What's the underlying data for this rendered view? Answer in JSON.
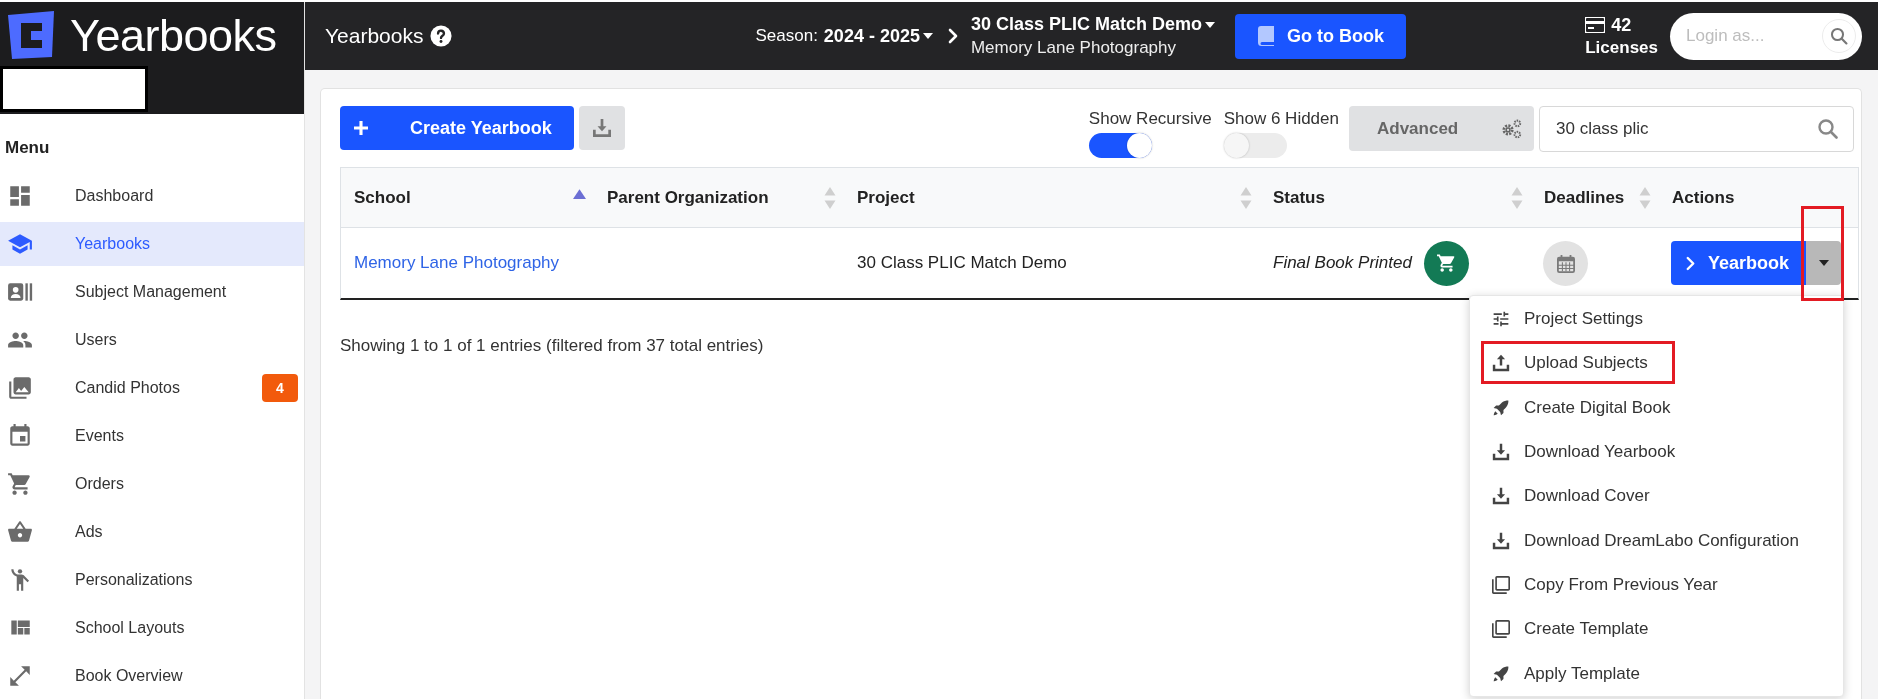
{
  "brand": {
    "name": "Yearbooks"
  },
  "header": {
    "title": "Yearbooks",
    "season_label": "Season:",
    "season": "2024 - 2025",
    "project": "30 Class PLIC Match Demo",
    "school": "Memory Lane Photography",
    "go_button": "Go to Book",
    "licenses_count": "42",
    "licenses_label": "Licenses",
    "login_field": {
      "placeholder": "Login as..."
    }
  },
  "sidebar": {
    "heading": "Menu",
    "items": [
      {
        "label": "Dashboard",
        "selected": false
      },
      {
        "label": "Yearbooks",
        "selected": true
      },
      {
        "label": "Subject Management",
        "selected": false
      },
      {
        "label": "Users",
        "selected": false
      },
      {
        "label": "Candid Photos",
        "selected": false,
        "badge": "4"
      },
      {
        "label": "Events",
        "selected": false
      },
      {
        "label": "Orders",
        "selected": false
      },
      {
        "label": "Ads",
        "selected": false
      },
      {
        "label": "Personalizations",
        "selected": false
      },
      {
        "label": "School Layouts",
        "selected": false
      },
      {
        "label": "Book Overview",
        "selected": false
      }
    ]
  },
  "toolbar": {
    "create_button": "Create Yearbook",
    "toggles": [
      {
        "label": "Show Recursive",
        "on": true
      },
      {
        "label": "Show 6 Hidden",
        "on": false
      }
    ],
    "advanced_button": "Advanced",
    "search": {
      "value": "30 class plic"
    }
  },
  "table": {
    "columns": [
      {
        "label": "School",
        "sortable": true,
        "sorted": true
      },
      {
        "label": "Parent Organization",
        "sortable": true,
        "sorted": false
      },
      {
        "label": "Project",
        "sortable": true,
        "sorted": false
      },
      {
        "label": "Status",
        "sortable": true,
        "sorted": false
      },
      {
        "label": "Deadlines",
        "sortable": true,
        "sorted": false
      },
      {
        "label": "Actions",
        "sortable": false,
        "sorted": false
      }
    ],
    "rows": [
      {
        "school": "Memory Lane Photography",
        "project": "30 Class PLIC Match Demo",
        "status": "Final Book Printed",
        "action_button": "Yearbook",
        "menu_open": true,
        "toggle_highlighted": true
      }
    ]
  },
  "entries_info": "Showing 1 to 1 of 1 entries (filtered from 37 total entries)",
  "row_menu": {
    "items": [
      {
        "label": "Project Settings",
        "highlighted": false
      },
      {
        "label": "Upload Subjects",
        "highlighted": true
      },
      {
        "label": "Create Digital Book",
        "highlighted": false
      },
      {
        "label": "Download Yearbook",
        "highlighted": false
      },
      {
        "label": "Download Cover",
        "highlighted": false
      },
      {
        "label": "Download DreamLabo Configuration",
        "highlighted": false
      },
      {
        "label": "Copy From Previous Year",
        "highlighted": false
      },
      {
        "label": "Create Template",
        "highlighted": false
      },
      {
        "label": "Apply Template",
        "highlighted": false
      }
    ]
  }
}
